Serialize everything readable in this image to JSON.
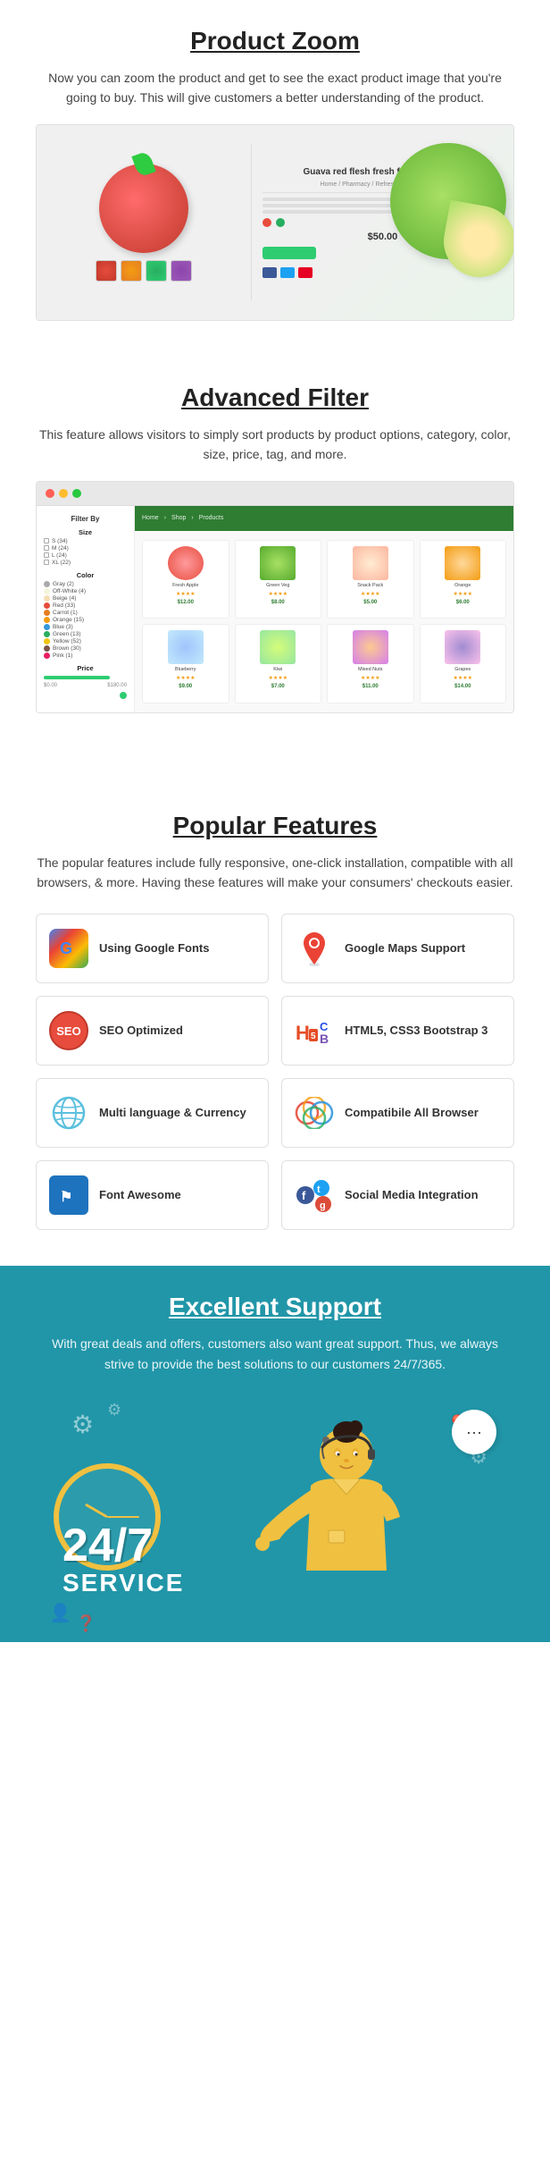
{
  "productZoom": {
    "title": "Product Zoom",
    "description": "Now you can zoom the product and get to see the exact product image that you're going to buy. This will give customers a better understanding of the product.",
    "productTitle": "Guava red flesh fresh fruit plants tree",
    "price": "$50.00"
  },
  "advancedFilter": {
    "title": "Advanced Filter",
    "description": "This feature allows visitors to simply sort products by product options, category, color, size, price, tag, and more.",
    "filterByLabel": "Filter By",
    "sizeLabel": "Size",
    "sizes": [
      "S (34)",
      "M (24)",
      "L (24)",
      "XL (22)"
    ],
    "colorLabel": "Color",
    "colors": [
      "Gray (2)",
      "Off-White (4)",
      "Beige (4)",
      "Red (33)",
      "Carrot (1)",
      "Orange (15)",
      "Blue (3)",
      "Green (13)",
      "Yellow (52)",
      "Brown (30)",
      "Pink (1)"
    ],
    "priceLabel": "Price",
    "priceRange": "$0.00 — $180.00"
  },
  "popularFeatures": {
    "title": "Popular Features",
    "description": "The popular features include  fully responsive, one-click installation, compatible with all browsers, & more. Having these features will make your consumers' checkouts easier.",
    "features": [
      {
        "id": "google-fonts",
        "label": "Using Google Fonts",
        "iconType": "google-fonts"
      },
      {
        "id": "google-maps",
        "label": "Google Maps Support",
        "iconType": "google-maps"
      },
      {
        "id": "seo",
        "label": "SEO Optimized",
        "iconType": "seo"
      },
      {
        "id": "html5",
        "label": "HTML5, CSS3 Bootstrap 3",
        "iconType": "html5"
      },
      {
        "id": "multilang",
        "label": "Multi language & Currency",
        "iconType": "globe"
      },
      {
        "id": "browser",
        "label": "Compatibile All Browser",
        "iconType": "browser"
      },
      {
        "id": "font-awesome",
        "label": "Font Awesome",
        "iconType": "font-awesome"
      },
      {
        "id": "social",
        "label": "Social Media Integration",
        "iconType": "social"
      }
    ]
  },
  "excellentSupport": {
    "title": "Excellent Support",
    "description": "With great deals and offers, customers also want great support. Thus, we always strive to provide the best solutions to our customers 24/7/365.",
    "badge247": "24/7",
    "serviceLabel": "SERVICE"
  }
}
